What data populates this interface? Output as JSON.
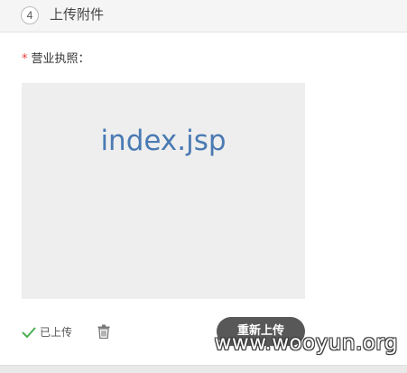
{
  "section": {
    "step_number": "4",
    "title": "上传附件"
  },
  "field": {
    "required_mark": "*",
    "label": "营业执照："
  },
  "preview": {
    "filename": "index.jsp"
  },
  "status": {
    "icon": "check-icon",
    "text": "已上传",
    "color": "#4caf50"
  },
  "actions": {
    "delete_icon": "trash-icon",
    "reupload_label": "重新上传"
  },
  "watermark": {
    "text": "www.wooyun.org"
  }
}
